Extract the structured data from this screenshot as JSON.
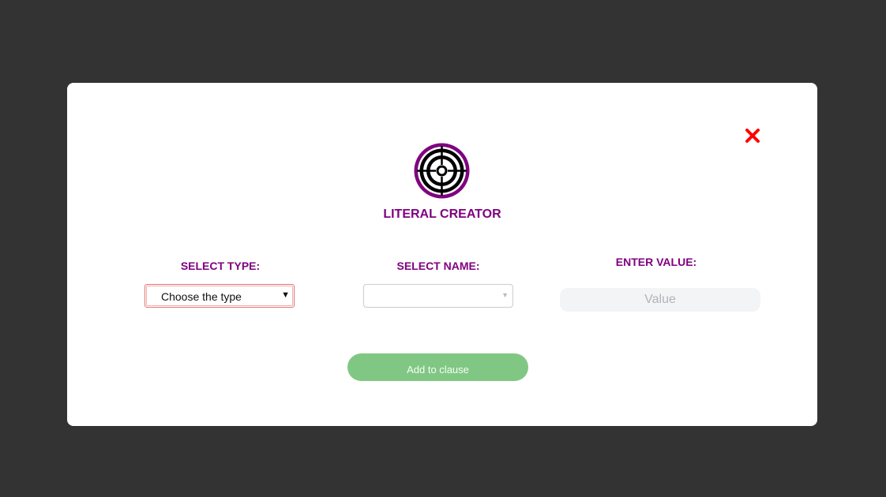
{
  "modal": {
    "title": "LITERAL CREATOR",
    "close_icon": "close-icon",
    "logo_icon": "target-crosshair-icon"
  },
  "form": {
    "type": {
      "label": "SELECT TYPE:",
      "selected": "Choose the type"
    },
    "name": {
      "label": "SELECT NAME:",
      "selected": ""
    },
    "value": {
      "label": "ENTER VALUE:",
      "placeholder": "Value",
      "value": ""
    }
  },
  "actions": {
    "add_label": "Add to clause"
  },
  "colors": {
    "backdrop": "#333333",
    "accent": "#800080",
    "close": "#ff0000",
    "add_button": "#81c784"
  }
}
